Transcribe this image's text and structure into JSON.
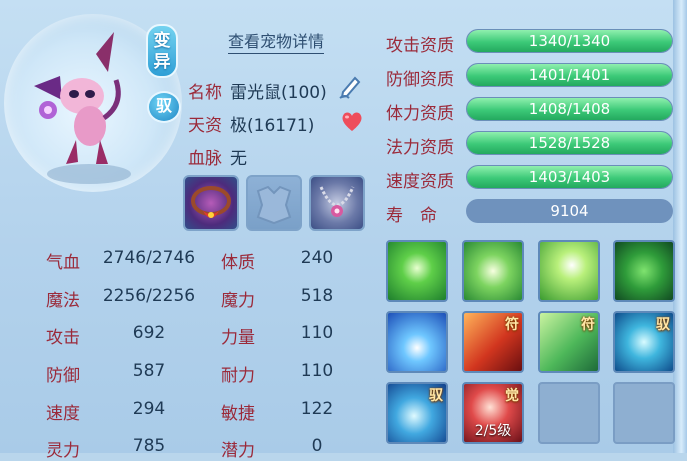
{
  "pet": {
    "detail_link": "查看宠物详情",
    "badge_variant": "变异",
    "badge_tame": "驭",
    "name_label": "名称",
    "name_value": "雷光鼠(100)",
    "talent_label": "天资",
    "talent_value": "极(16171)",
    "bloodline_label": "血脉",
    "bloodline_value": "无"
  },
  "attributes": [
    {
      "label": "气血",
      "value": "2746/2746",
      "label2": "体质",
      "value2": "240"
    },
    {
      "label": "魔法",
      "value": "2256/2256",
      "label2": "魔力",
      "value2": "518"
    },
    {
      "label": "攻击",
      "value": "692",
      "label2": "力量",
      "value2": "110"
    },
    {
      "label": "防御",
      "value": "587",
      "label2": "耐力",
      "value2": "110"
    },
    {
      "label": "速度",
      "value": "294",
      "label2": "敏捷",
      "value2": "122"
    },
    {
      "label": "灵力",
      "value": "785",
      "label2": "潜力",
      "value2": "0"
    }
  ],
  "aptitudes": [
    {
      "label": "攻击资质",
      "text": "1340/1340",
      "fill": 1.0
    },
    {
      "label": "防御资质",
      "text": "1401/1401",
      "fill": 1.0
    },
    {
      "label": "体力资质",
      "text": "1408/1408",
      "fill": 1.0
    },
    {
      "label": "法力资质",
      "text": "1528/1528",
      "fill": 1.0
    },
    {
      "label": "速度资质",
      "text": "1403/1403",
      "fill": 1.0
    }
  ],
  "life": {
    "label": "寿　命",
    "value": "9104"
  },
  "skills": [
    {
      "icon": "green-figure-skill-icon",
      "tag": ""
    },
    {
      "icon": "green-hand-skill-icon",
      "tag": ""
    },
    {
      "icon": "green-palm-skill-icon",
      "tag": ""
    },
    {
      "icon": "green-cat-skill-icon",
      "tag": ""
    },
    {
      "icon": "blue-lightning-skill-icon",
      "tag": ""
    },
    {
      "icon": "red-talisman-skill-icon",
      "tag": "符"
    },
    {
      "icon": "green-talisman-skill-icon",
      "tag": "符"
    },
    {
      "icon": "blue-shield-skill-icon",
      "tag": "驭"
    },
    {
      "icon": "blue-shield-tame-skill-icon",
      "tag": "驭"
    },
    {
      "icon": "red-awaken-skill-icon",
      "tag": "觉",
      "level": "2/5级"
    },
    {
      "icon": "empty-skill-slot",
      "tag": ""
    },
    {
      "icon": "empty-skill-slot",
      "tag": ""
    }
  ]
}
